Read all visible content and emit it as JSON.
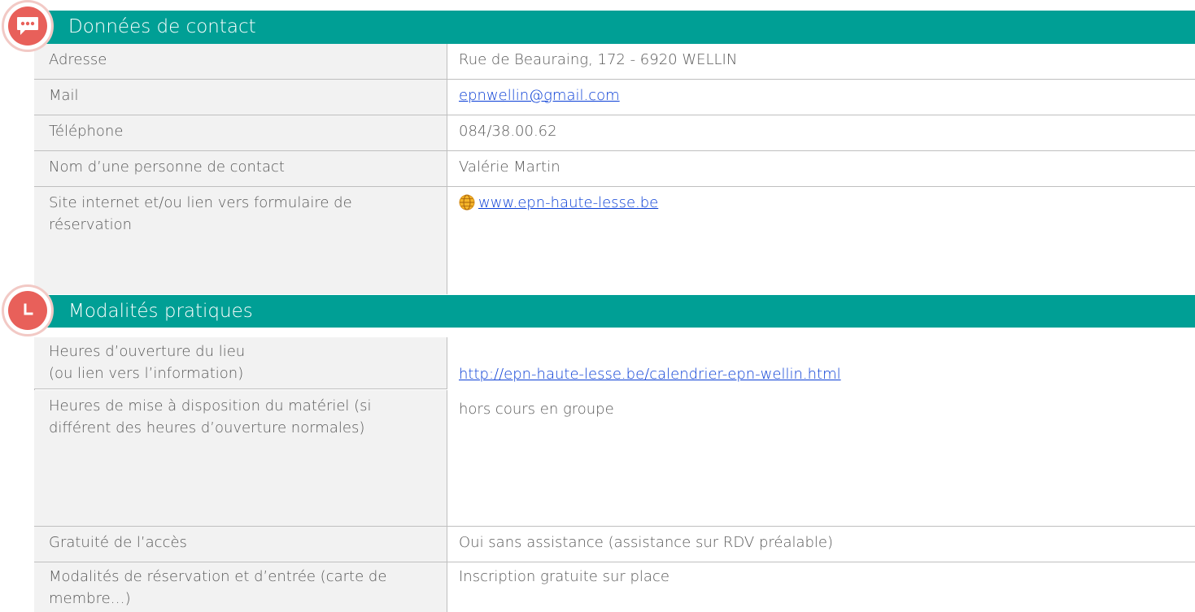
{
  "section1": {
    "title": "Données de contact",
    "rows": [
      {
        "label": "Adresse",
        "value": "Rue de Beauraing, 172 - 6920 WELLIN"
      },
      {
        "label": "Mail",
        "value": "epnwellin@gmail.com"
      },
      {
        "label": "Téléphone",
        "value": "084/38.00.62"
      },
      {
        "label": "Nom d’une personne de contact",
        "value": "Valérie Martin"
      },
      {
        "label": "Site internet et/ou lien vers formulaire de réservation",
        "value": "www.epn-haute-lesse.be"
      }
    ]
  },
  "section2": {
    "title": "Modalités pratiques",
    "rows": [
      {
        "label": "Heures d’ouverture du lieu\n(ou lien vers l’information)",
        "value": "http://epn-haute-lesse.be/calendrier-epn-wellin.html"
      },
      {
        "label": "Heures de mise à disposition du matériel (si différent des heures d’ouverture normales)",
        "value": "hors cours en groupe"
      },
      {
        "label": "Gratuité de l’accès",
        "value": "Oui sans assistance (assistance sur RDV préalable)"
      },
      {
        "label": "Modalités de réservation et d’entrée (carte de membre…)",
        "value": "Inscription gratuite sur place"
      }
    ]
  },
  "icons": {
    "section1_icon": "chat-bubble-icon",
    "section2_icon": "clock-icon",
    "website_icon": "globe-icon"
  },
  "colors": {
    "header_bg": "#009f95",
    "badge": "#e8605a",
    "label_bg": "#f2f2f2",
    "link": "#0b3fd6"
  }
}
